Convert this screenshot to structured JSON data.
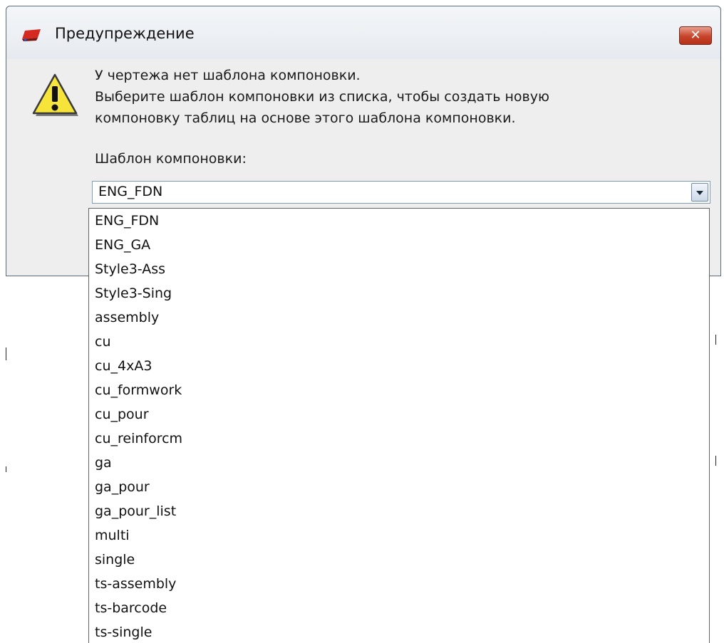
{
  "dialog": {
    "title": "Предупреждение",
    "close_label": "✕",
    "message_lines": [
      "У чертежа нет шаблона компоновки.",
      "Выберите шаблон компоновки из списка, чтобы создать новую",
      "компоновку таблиц на основе этого шаблона компоновки."
    ],
    "field_label": "Шаблон компоновки:",
    "selected_template": "ENG_FDN",
    "template_options": [
      "ENG_FDN",
      "ENG_GA",
      "Style3-Ass",
      "Style3-Sing",
      "assembly",
      "cu",
      "cu_4xA3",
      "cu_formwork",
      "cu_pour",
      "cu_reinforcm",
      "ga",
      "ga_pour",
      "ga_pour_list",
      "multi",
      "single",
      "ts-assembly",
      "ts-barcode",
      "ts-single"
    ]
  },
  "icons": {
    "app": "tekla-app-icon",
    "warning": "warning-triangle-icon",
    "close": "close-icon",
    "dropdown": "chevron-down-icon"
  },
  "colors": {
    "close_button": "#c7432a",
    "warning_fill": "#f7e43a",
    "dialog_bg": "#eeeeee"
  }
}
